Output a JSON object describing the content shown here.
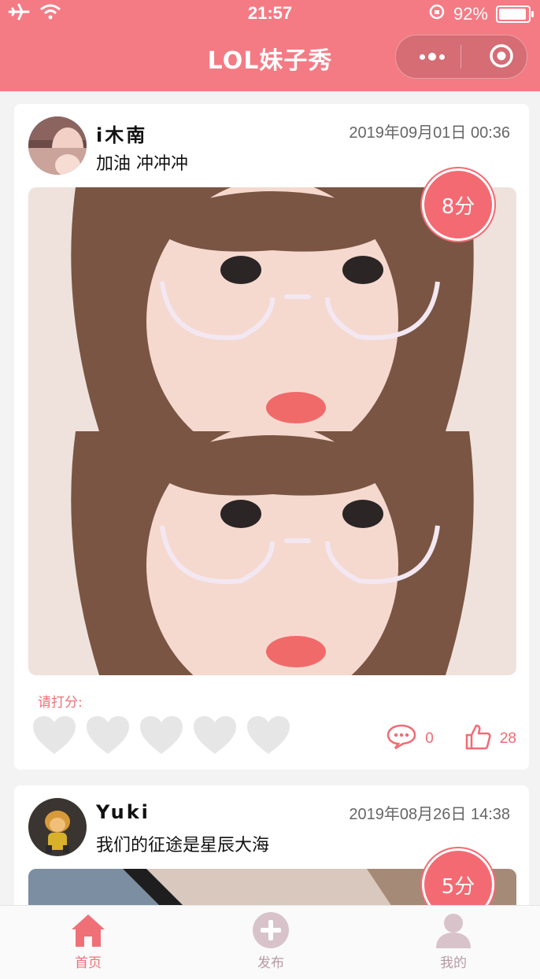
{
  "status_bar": {
    "time": "21:57",
    "battery": "92%"
  },
  "nav": {
    "title": "LOL妹子秀"
  },
  "posts": [
    {
      "username": "i木南",
      "timestamp": "2019年09月01日 00:36",
      "caption": "加油 冲冲冲",
      "score": "8分",
      "rate_label": "请打分:",
      "comments": "0",
      "likes": "28"
    },
    {
      "username": "Yuki",
      "timestamp": "2019年08月26日 14:38",
      "caption": "我们的征途是星辰大海",
      "score": "5分"
    }
  ],
  "tabbar": {
    "items": [
      {
        "label": "首页",
        "icon": "home-icon",
        "active": true
      },
      {
        "label": "发布",
        "icon": "plus-circle-icon",
        "active": false
      },
      {
        "label": "我的",
        "icon": "user-icon",
        "active": false
      }
    ]
  },
  "colors": {
    "accent": "#f47b84",
    "badge": "#f36a73",
    "heart_empty": "#e6e6e6",
    "tab_active": "#f07078",
    "tab_inactive": "#b89aa6"
  }
}
